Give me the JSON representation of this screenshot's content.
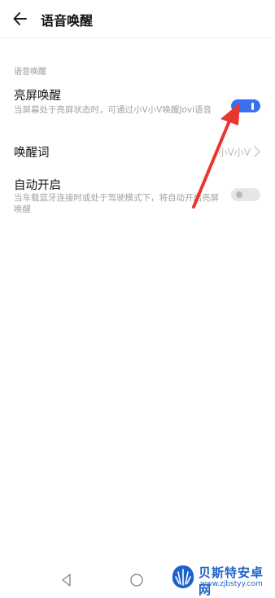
{
  "header": {
    "title": "语音唤醒"
  },
  "section": {
    "label": "语音唤醒"
  },
  "settings": {
    "screen_wake": {
      "title": "亮屏唤醒",
      "desc": "当屏幕处于亮屏状态时，可通过小V小V唤醒Jovi语音",
      "enabled": true
    },
    "wake_word": {
      "title": "唤醒词",
      "value": "小V小V"
    },
    "auto_start": {
      "title": "自动开启",
      "desc": "当车载蓝牙连接时或处于驾驶模式下，将自动开启亮屏唤醒",
      "enabled": false
    }
  },
  "colors": {
    "toggle_on": "#3a6ff0",
    "toggle_off": "#e6e6e6",
    "annotation_arrow": "#e8372f",
    "watermark": "#1a63c9"
  },
  "icons": {
    "back": "back-arrow-icon",
    "chevron": "chevron-right-icon",
    "nav_back": "triangle-back-icon",
    "nav_home": "circle-home-icon"
  },
  "watermark": {
    "name": "贝斯特安卓网",
    "url": "www.zjbstyy.com"
  }
}
